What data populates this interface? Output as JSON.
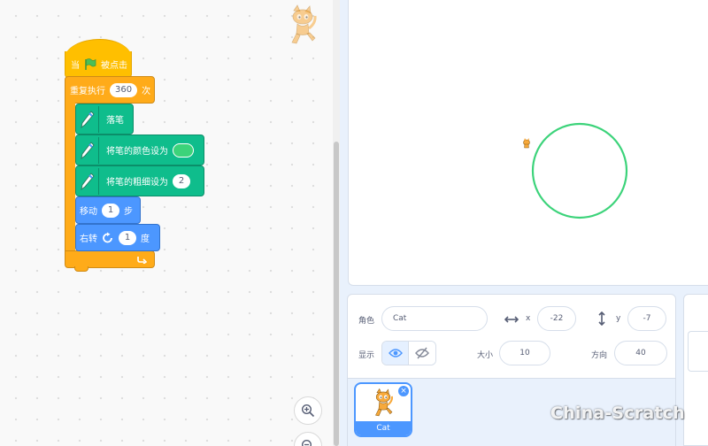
{
  "code": {
    "hat": {
      "prefix": "当",
      "suffix": "被点击"
    },
    "repeat": {
      "label": "重复执行",
      "times": "360",
      "suffix": "次"
    },
    "pen_down": {
      "label": "落笔"
    },
    "set_color": {
      "label": "将笔的颜色设为",
      "color": "#3cd37a"
    },
    "set_size": {
      "label": "将笔的粗细设为",
      "value": "2"
    },
    "move": {
      "label": "移动",
      "value": "1",
      "suffix": "步"
    },
    "turn": {
      "label": "右转",
      "value": "1",
      "suffix": "度"
    }
  },
  "stage": {
    "circle_color": "#3cd37a"
  },
  "sprite_info": {
    "sprite_label": "角色",
    "sprite_name": "Cat",
    "x_label": "x",
    "x_value": "-22",
    "y_label": "y",
    "y_value": "-7",
    "show_label": "显示",
    "size_label": "大小",
    "size_value": "10",
    "direction_label": "方向",
    "direction_value": "40"
  },
  "sprite_list": {
    "items": [
      {
        "name": "Cat"
      }
    ]
  },
  "watermark": "China-Scratch",
  "colors": {
    "accent": "#4c97ff",
    "control": "#ffab19",
    "events": "#ffbf00",
    "pen": "#0fbd8c"
  }
}
